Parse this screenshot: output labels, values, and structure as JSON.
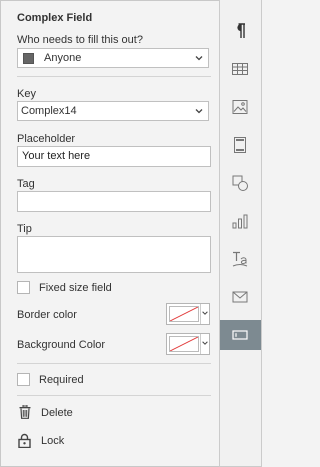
{
  "panel": {
    "title": "Complex Field",
    "who_label": "Who needs to fill this out?",
    "who_value": "Anyone",
    "key_label": "Key",
    "key_value": "Complex14",
    "placeholder_label": "Placeholder",
    "placeholder_value": "Your text here",
    "tag_label": "Tag",
    "tag_value": "",
    "tip_label": "Tip",
    "tip_value": "",
    "fixed_size_label": "Fixed size field",
    "border_color_label": "Border color",
    "background_color_label": "Background Color",
    "required_label": "Required",
    "delete_label": "Delete",
    "lock_label": "Lock"
  },
  "colors": {
    "accent_active": "#7d8a91",
    "swatch": "#666666",
    "no_color_line": "#e23b3b"
  },
  "sidebar": {
    "items": [
      {
        "icon": "paragraph-icon"
      },
      {
        "icon": "table-icon"
      },
      {
        "icon": "image-icon"
      },
      {
        "icon": "header-footer-icon"
      },
      {
        "icon": "shape-icon"
      },
      {
        "icon": "chart-icon"
      },
      {
        "icon": "text-art-icon"
      },
      {
        "icon": "mail-merge-icon"
      },
      {
        "icon": "form-field-icon",
        "active": true
      }
    ]
  }
}
